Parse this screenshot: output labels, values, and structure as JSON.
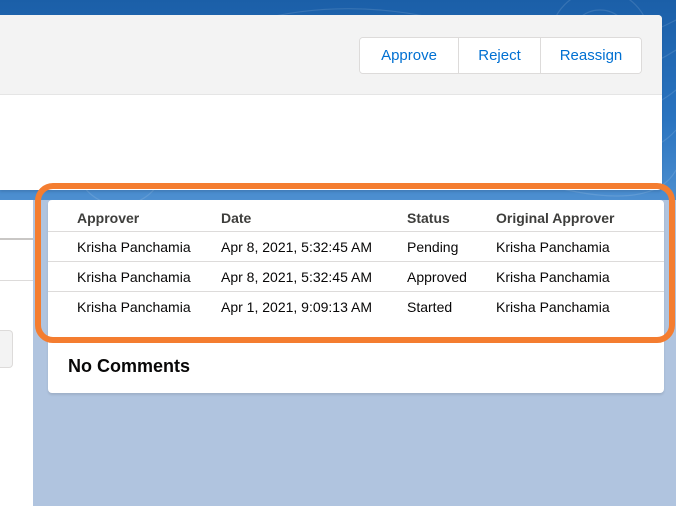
{
  "actions": {
    "approve_label": "Approve",
    "reject_label": "Reject",
    "reassign_label": "Reassign"
  },
  "approval_history": {
    "columns": [
      "Approver",
      "Date",
      "Status",
      "Original Approver"
    ],
    "rows": [
      [
        "Krisha Panchamia",
        "Apr 8, 2021, 5:32:45 AM",
        "Pending",
        "Krisha Panchamia"
      ],
      [
        "Krisha Panchamia",
        "Apr 8, 2021, 5:32:45 AM",
        "Approved",
        "Krisha Panchamia"
      ],
      [
        "Krisha Panchamia",
        "Apr 1, 2021, 9:09:13 AM",
        "Started",
        "Krisha Panchamia"
      ]
    ]
  },
  "comments": {
    "empty_label": "No Comments"
  },
  "colors": {
    "link": "#0070d2",
    "highlight": "#f47d30",
    "page_background": "#b0c4df"
  }
}
